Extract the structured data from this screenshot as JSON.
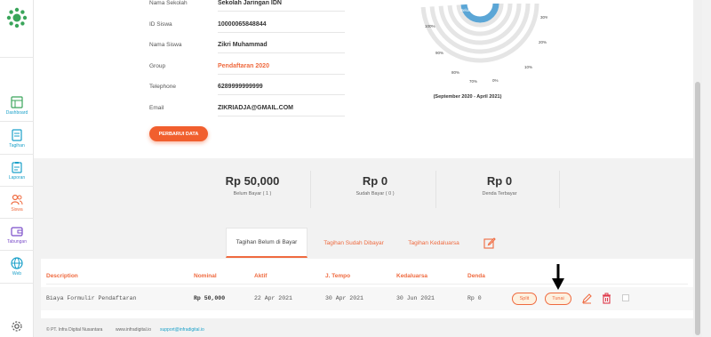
{
  "sidebar": {
    "items": [
      {
        "label": "Dashboard",
        "icon": "dashboard-icon"
      },
      {
        "label": "Tagihan",
        "icon": "invoice-icon"
      },
      {
        "label": "Laporan",
        "icon": "report-icon"
      },
      {
        "label": "Siswa",
        "icon": "students-icon"
      },
      {
        "label": "Tabungan",
        "icon": "wallet-icon"
      },
      {
        "label": "Web",
        "icon": "globe-icon"
      }
    ]
  },
  "profile": {
    "rows": [
      {
        "key": "Nama Sekolah",
        "value": "Sekolah Jaringan IDN"
      },
      {
        "key": "ID Siswa",
        "value": "10000065848844"
      },
      {
        "key": "Nama Siswa",
        "value": "Zikri Muhammad"
      },
      {
        "key": "Group",
        "value": "Pendaftaran 2020"
      },
      {
        "key": "Telephone",
        "value": "6289999999999"
      },
      {
        "key": "Email",
        "value": "ZIKRIADJA@GMAIL.COM"
      }
    ],
    "update_button": "PERBARUI DATA"
  },
  "chart_data": {
    "type": "radial-bar",
    "caption": "(September 2020 - April 2021)",
    "tick_labels": [
      "100%",
      "90%",
      "80%",
      "70%",
      "0%",
      "10%",
      "20%",
      "30%",
      "40%",
      "50%"
    ],
    "series": [
      {
        "name": "Belum Bayar",
        "value": 100
      }
    ],
    "colors": {
      "belum_bayar": "#5ba6d6",
      "track": "#e5e5e5"
    }
  },
  "summary": [
    {
      "value": "Rp 50,000",
      "label": "Belum Bayar ( 1 )"
    },
    {
      "value": "Rp 0",
      "label": "Sudah Bayar ( 0 )"
    },
    {
      "value": "Rp 0",
      "label": "Denda Terbayar"
    }
  ],
  "tabs": [
    {
      "label": "Tagihan Belum di Bayar",
      "active": true
    },
    {
      "label": "Tagihan Sudah Dibayar",
      "active": false
    },
    {
      "label": "Tagihan Kedaluarsa",
      "active": false
    }
  ],
  "table": {
    "headers": [
      "Description",
      "Nominal",
      "Aktif",
      "J. Tempo",
      "Kedaluarsa",
      "Denda"
    ],
    "rows": [
      {
        "description": "Biaya Formulir Pendaftaran",
        "nominal": "Rp 50,000",
        "aktif": "22 Apr 2021",
        "jtempo": "30 Apr 2021",
        "kedaluarsa": "30 Jun 2021",
        "denda": "Rp 0",
        "split_label": "Split",
        "tunai_label": "Tunai"
      }
    ]
  },
  "footer": {
    "copyright": "© PT. Infra Digital Nusantara",
    "website": "www.infradigital.io",
    "email": "support@infradigital.io"
  },
  "colors": {
    "accent": "#ef6a3f",
    "link": "#1aa0c9",
    "brand_green": "#3aa55a"
  }
}
